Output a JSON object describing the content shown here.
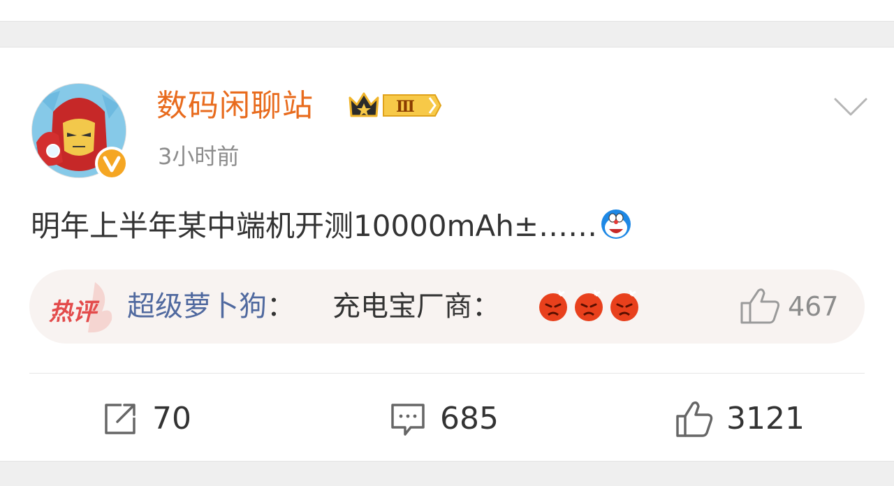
{
  "post": {
    "username": "数码闲聊站",
    "vip_level": "Ⅲ",
    "time": "3小时前",
    "text": "明年上半年某中端机开测10000mAh±……",
    "emoji_icon": "doraemon-emoji"
  },
  "hot_comment": {
    "tag": "热评",
    "user": "超级萝卜狗",
    "separator": "：",
    "text": "充电宝厂商：",
    "emojis": [
      "angry-emoji",
      "angry-emoji",
      "angry-emoji"
    ],
    "like_count": "467"
  },
  "actions": {
    "repost_count": "70",
    "comment_count": "685",
    "like_count": "3121"
  },
  "colors": {
    "username": "#e86b1d",
    "hot_user": "#50699f",
    "hot_tag": "#e34b4b",
    "text": "#333333",
    "muted": "#8c8c8c"
  }
}
